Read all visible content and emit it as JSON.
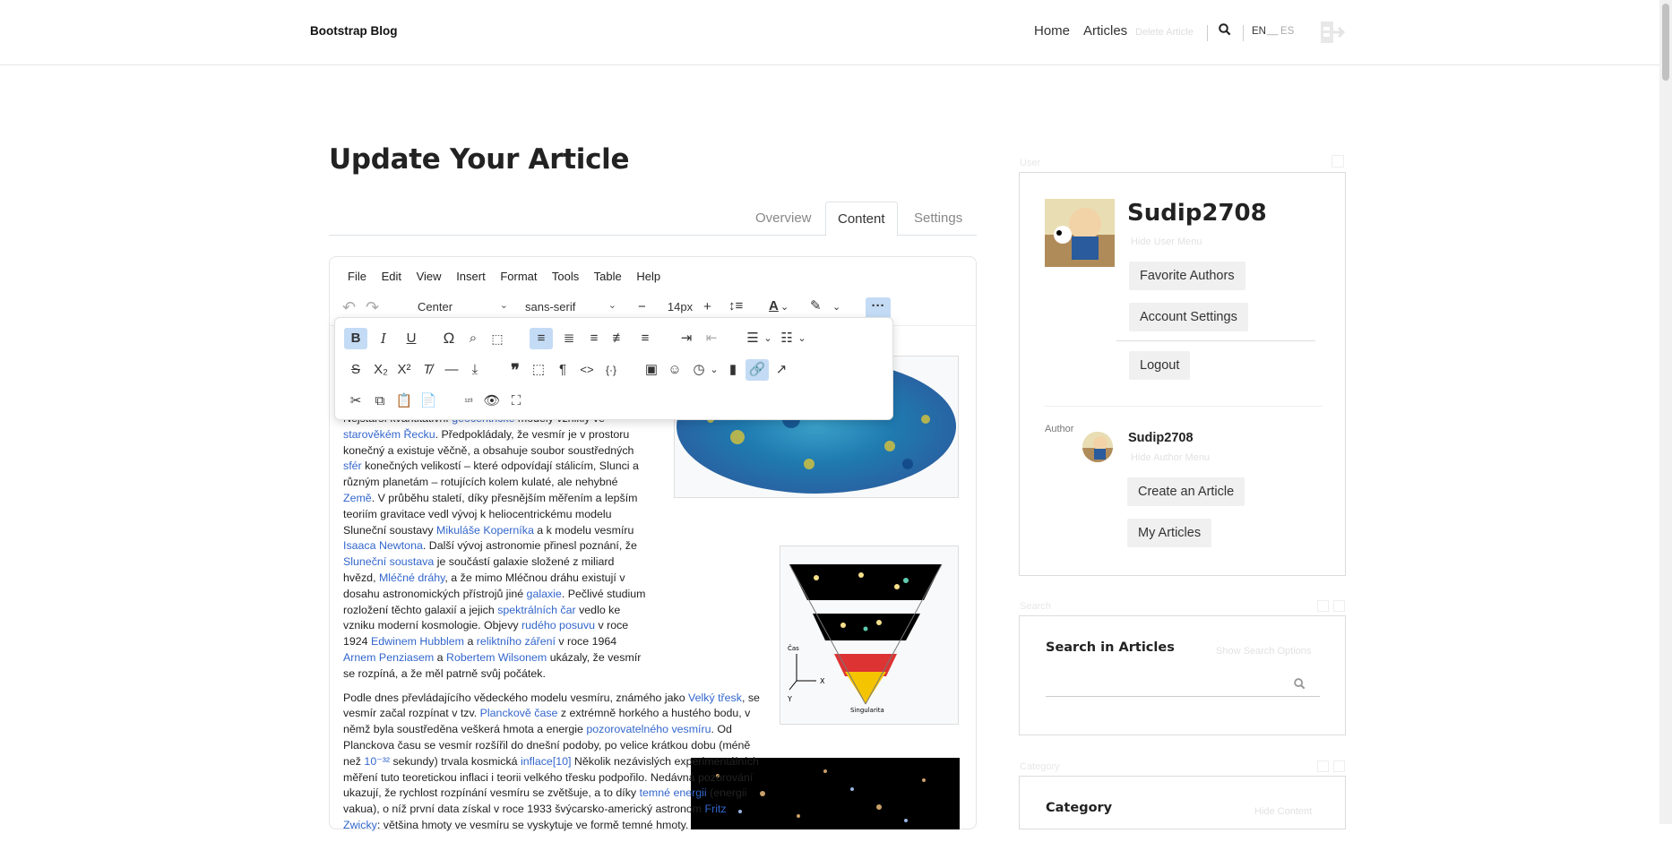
{
  "nav": {
    "brand": "Bootstrap Blog",
    "home": "Home",
    "articles": "Articles",
    "delete": "Delete Article",
    "lang_en": "EN",
    "lang_sep": "__",
    "lang_es": "ES"
  },
  "page": {
    "title": "Update Your Article"
  },
  "tabs": [
    {
      "label": "Overview"
    },
    {
      "label": "Content"
    },
    {
      "label": "Settings"
    }
  ],
  "editor": {
    "menu": [
      "File",
      "Edit",
      "View",
      "Insert",
      "Format",
      "Tools",
      "Table",
      "Help"
    ],
    "block_format": "Center",
    "font_family": "sans-serif",
    "font_size": "14px"
  },
  "article": {
    "p1": [
      {
        "t": "Nejstarší kvantitativní "
      },
      {
        "l": "geocentrické"
      },
      {
        "t": " modely vzniklý ve "
      },
      {
        "l": "starověkém Řecku"
      },
      {
        "t": ". Předpokládaly, že vesmír je v prostoru konečný a existuje věčně, a obsahuje soubor soustředných "
      },
      {
        "l": "sfér"
      },
      {
        "t": " konečných velikostí – které odpovídají stálicím, Slunci a různým planetám – rotujících kolem kulaté, ale nehybné "
      },
      {
        "l": "Země"
      },
      {
        "t": ". V průběhu staletí, díky přesnějším měřením a lepším teoriím gravitace vedl vývoj k heliocentrickému modelu Sluneční soustavy "
      },
      {
        "l": "Mikuláše Koperníka"
      },
      {
        "t": " a k modelu vesmíru "
      },
      {
        "l": "Isaaca Newtona"
      },
      {
        "t": ". Další vývoj astronomie přinesl poznání, že "
      },
      {
        "l": "Sluneční soustava"
      },
      {
        "t": " je součástí galaxie složené z miliard hvězd, "
      },
      {
        "l": "Mléčné dráhy"
      },
      {
        "t": ", a že mimo Mléčnou dráhu existují v dosahu astronomických přístrojů jiné "
      },
      {
        "l": "galaxie"
      },
      {
        "t": ". Pečlivé studium rozložení těchto galaxií a jejich "
      },
      {
        "l": "spektrálních čar"
      },
      {
        "t": " vedlo ke vzniku moderní kosmologie. Objevy "
      },
      {
        "l": "rudého posuvu"
      },
      {
        "t": " v roce 1924 "
      },
      {
        "l": "Edwinem Hubblem"
      },
      {
        "t": " a "
      },
      {
        "l": "reliktního záření"
      },
      {
        "t": " v roce 1964 "
      },
      {
        "l": "Arnem Penziasem"
      },
      {
        "t": " a "
      },
      {
        "l": "Robertem Wilsonem"
      },
      {
        "t": " ukázaly, že vesmír se rozpíná, a že měl patrně svůj počátek."
      }
    ],
    "p2": [
      {
        "t": "Podle dnes převládajícího vědeckého modelu vesmíru, známého jako "
      },
      {
        "l": "Velký třesk"
      },
      {
        "t": ", se vesmír začal rozpínat v tzv. "
      },
      {
        "l": "Planckově čase"
      },
      {
        "t": " z extrémně horkého a hustého bodu, v němž byla soustředěna veškerá hmota a energie "
      },
      {
        "l": "pozorovatelného vesmíru"
      },
      {
        "t": ". Od Planckova času se vesmír rozšířil do dnešní podoby, po velice krátkou dobu (méně než "
      },
      {
        "l": "10⁻³²"
      },
      {
        "t": " sekundy) trvala kosmická "
      },
      {
        "l": "inflace"
      },
      {
        "l": "[10]"
      },
      {
        "t": " Několik nezávislých experimentálních měření tuto teoretickou inflaci i teorii velkého třesku podpořilo. Nedávná pozorování ukazují, že rychlost rozpínání vesmíru se zvětšuje, a to díky "
      },
      {
        "l": "temné energii"
      },
      {
        "t": " (energii vakua), o níž první data získal v roce 1933 švýcarsko-americký astronom "
      },
      {
        "l": "Fritz Zwicky"
      },
      {
        "t": ": většina hmoty ve vesmíru se vyskytuje ve formě temné hmoty."
      }
    ],
    "diagram": {
      "cas": "Čas",
      "x": "X",
      "y": "Y",
      "singularity": "Singularita"
    }
  },
  "user_card": {
    "label": "User",
    "username": "Sudip2708",
    "hide_menu": "Hide User Menu",
    "favorite": "Favorite Authors",
    "settings": "Account Settings",
    "logout": "Logout"
  },
  "author": {
    "label": "Author",
    "name": "Sudip2708",
    "hide_menu": "Hide Author Menu",
    "create": "Create an Article",
    "mine": "My Articles"
  },
  "search": {
    "label": "Search",
    "title": "Search in Articles",
    "options": "Show Search Options"
  },
  "category": {
    "label": "Category",
    "title": "Category",
    "hide": "Hide Content"
  }
}
